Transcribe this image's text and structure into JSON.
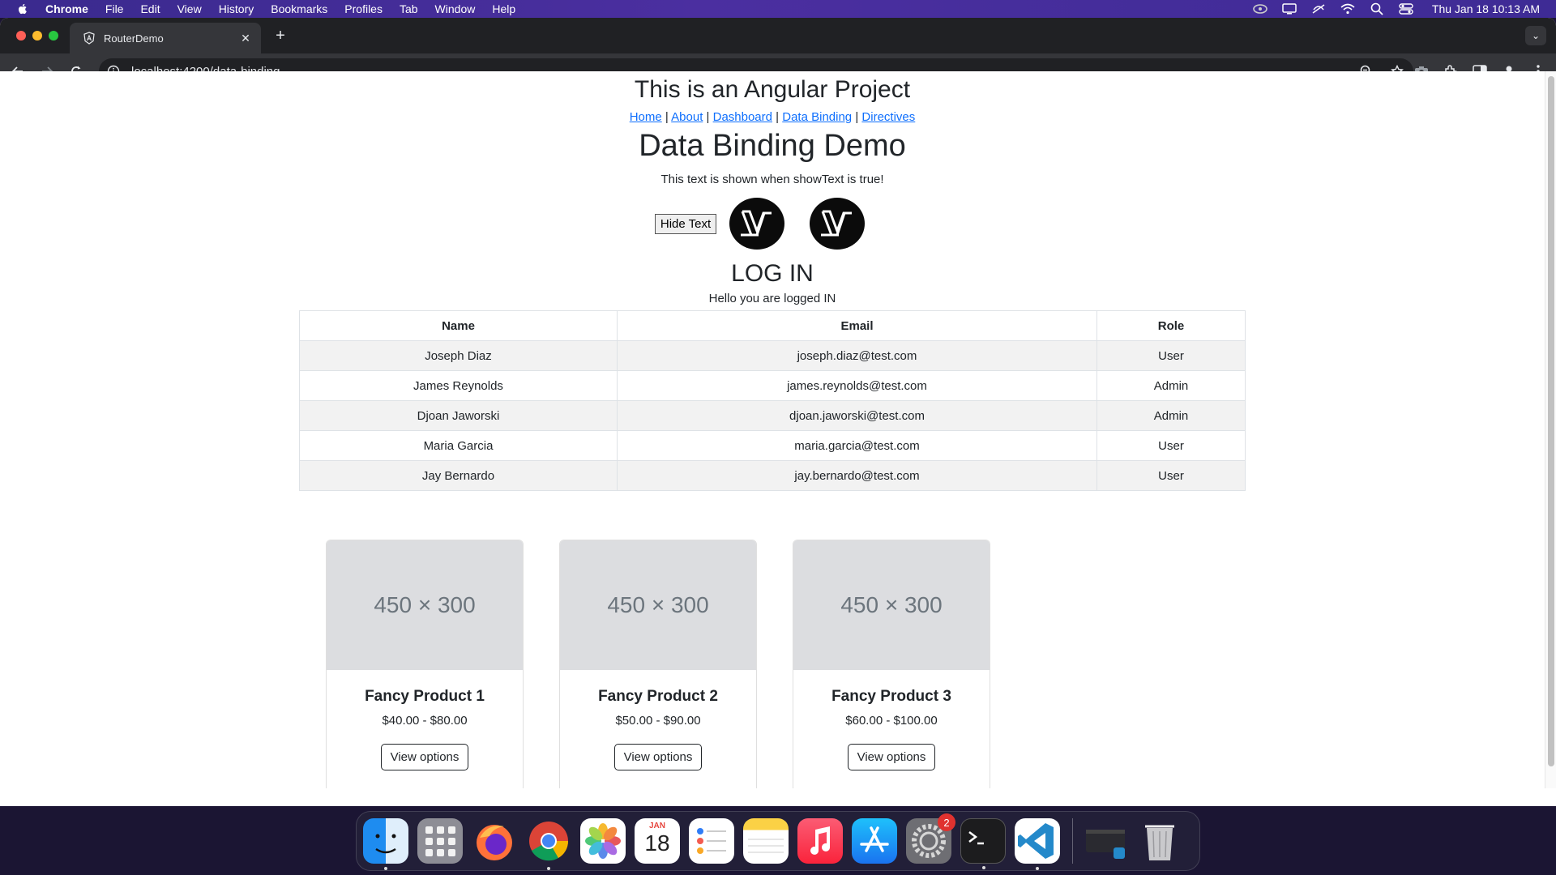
{
  "menubar": {
    "app_name": "Chrome",
    "items": [
      "File",
      "Edit",
      "View",
      "History",
      "Bookmarks",
      "Profiles",
      "Tab",
      "Window",
      "Help"
    ],
    "clock": "Thu Jan 18  10:13 AM"
  },
  "browser": {
    "tab_title": "RouterDemo",
    "url": "localhost:4200/data-binding"
  },
  "page": {
    "project_title": "This is an Angular Project",
    "nav": [
      "Home",
      "About",
      "Dashboard",
      "Data Binding",
      "Directives"
    ],
    "nav_separator": "|",
    "demo_title": "Data Binding Demo",
    "shown_text": "This text is shown when showText is true!",
    "hide_button": "Hide Text",
    "login_title": "LOG IN",
    "logged_in_text": "Hello you are logged IN",
    "table": {
      "headers": [
        "Name",
        "Email",
        "Role"
      ],
      "rows": [
        [
          "Joseph Diaz",
          "joseph.diaz@test.com",
          "User"
        ],
        [
          "James Reynolds",
          "james.reynolds@test.com",
          "Admin"
        ],
        [
          "Djoan Jaworski",
          "djoan.jaworski@test.com",
          "Admin"
        ],
        [
          "Maria Garcia",
          "maria.garcia@test.com",
          "User"
        ],
        [
          "Jay Bernardo",
          "jay.bernardo@test.com",
          "User"
        ]
      ]
    },
    "products": [
      {
        "image_text": "450 × 300",
        "name": "Fancy Product 1",
        "price": "$40.00 - $80.00",
        "button": "View options"
      },
      {
        "image_text": "450 × 300",
        "name": "Fancy Product 2",
        "price": "$50.00 - $90.00",
        "button": "View options"
      },
      {
        "image_text": "450 × 300",
        "name": "Fancy Product 3",
        "price": "$60.00 - $100.00",
        "button": "View options"
      }
    ]
  },
  "dock": {
    "calendar_month": "JAN",
    "calendar_day": "18",
    "settings_badge": "2",
    "apps": [
      "finder-icon",
      "launchpad-icon",
      "firefox-icon",
      "chrome-icon",
      "photos-icon",
      "calendar-icon",
      "reminders-icon",
      "notes-icon",
      "music-icon",
      "app-store-icon",
      "system-settings-icon",
      "terminal-icon",
      "vscode-icon",
      "window-thumbnail-icon",
      "trash-icon"
    ]
  }
}
